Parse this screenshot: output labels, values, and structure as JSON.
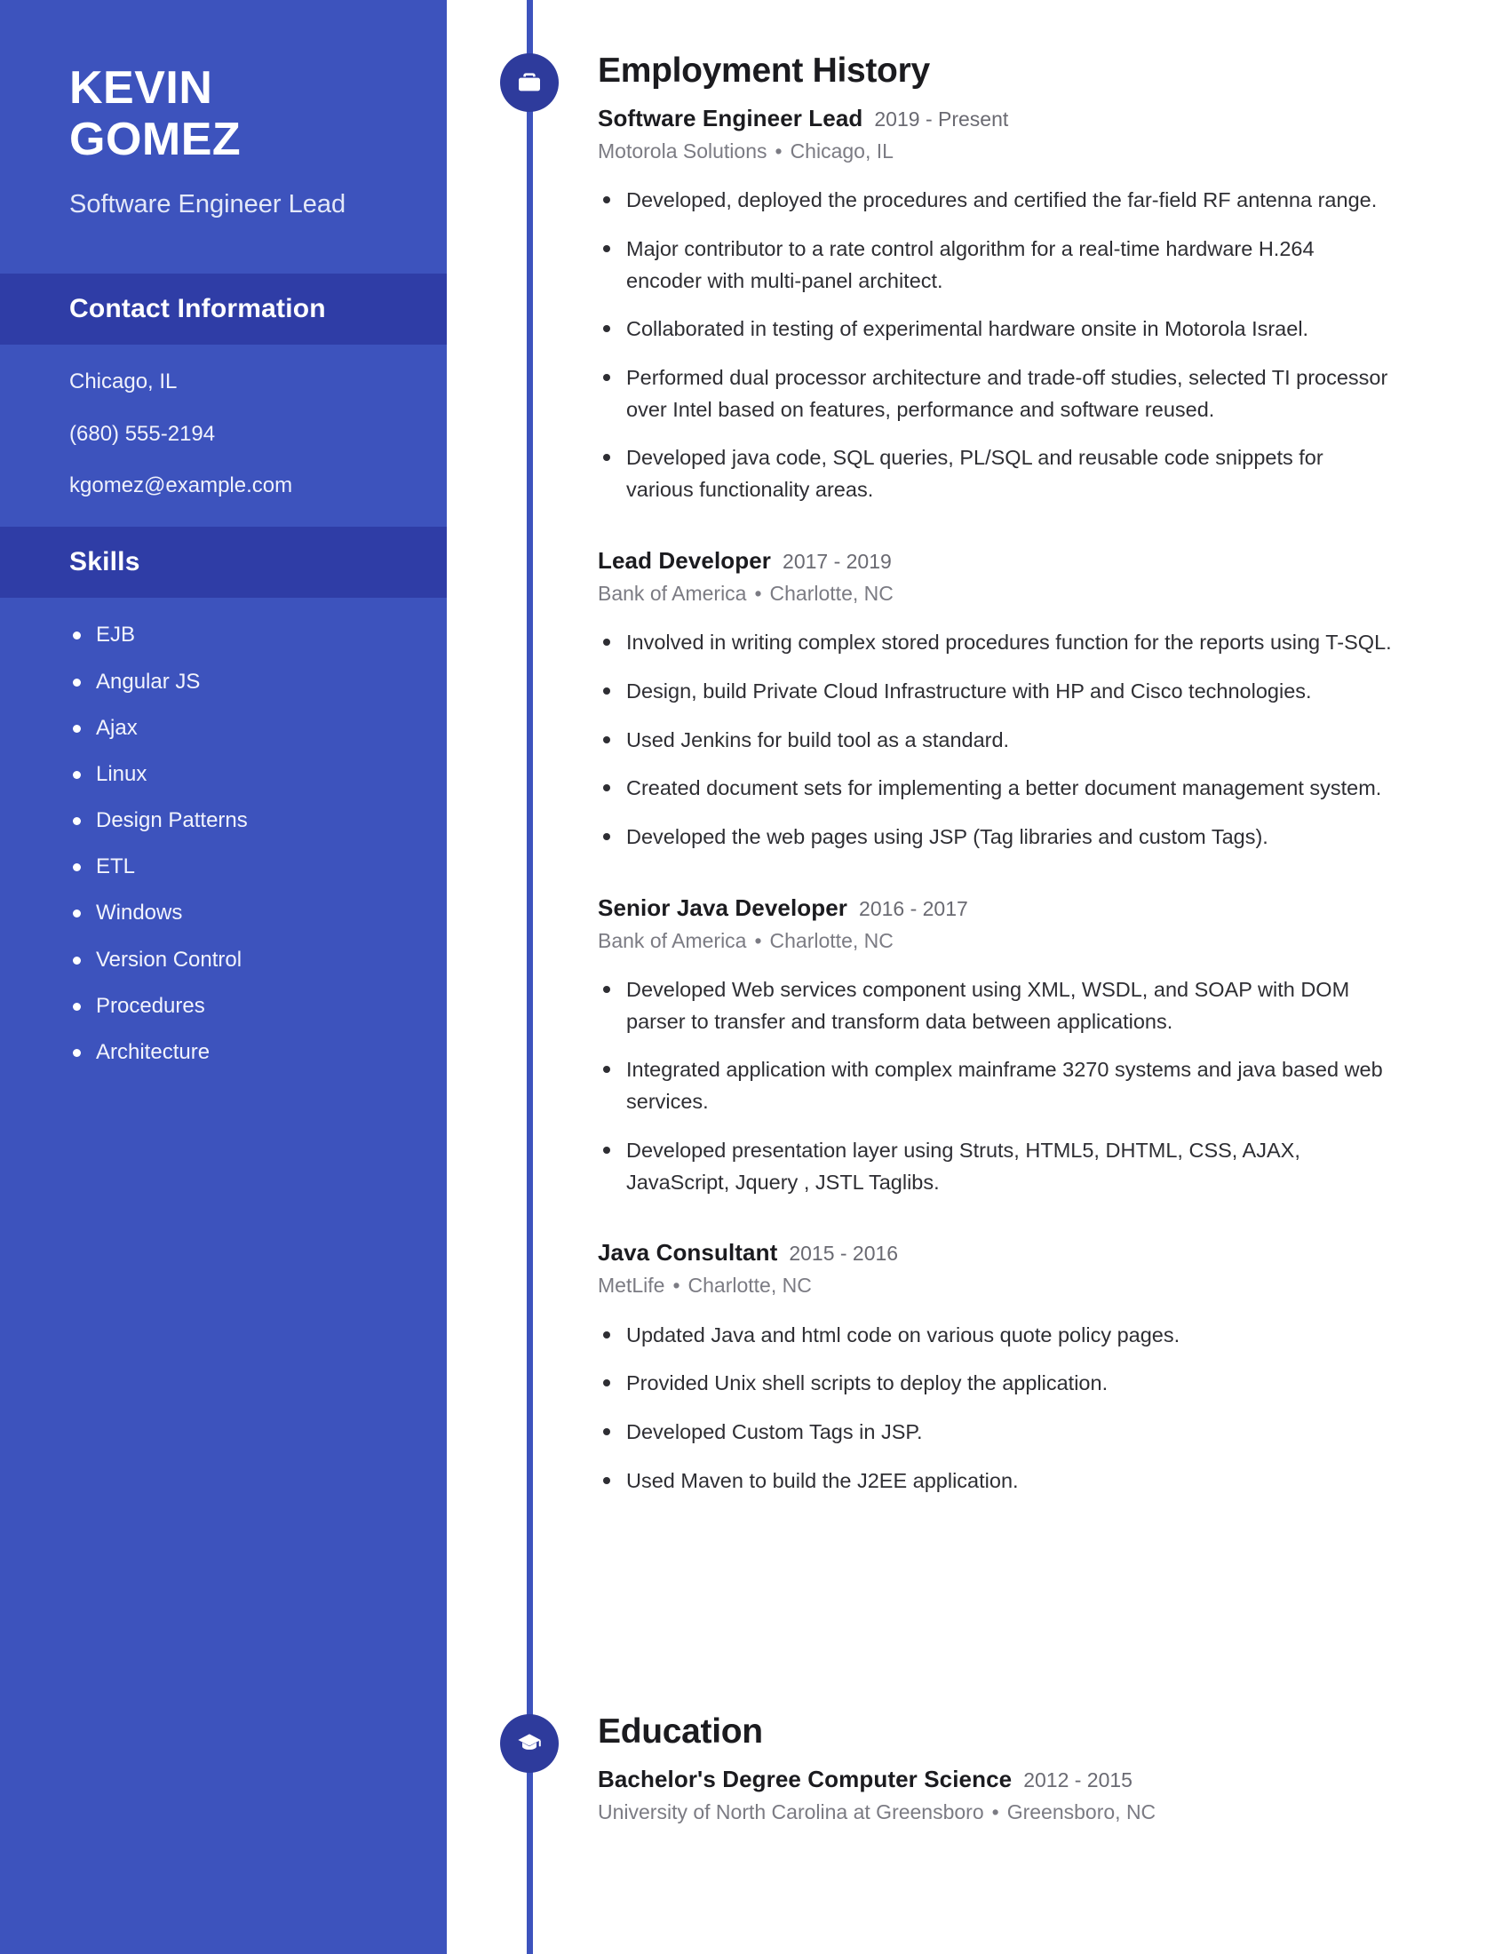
{
  "sidebar": {
    "name": "KEVIN GOMEZ",
    "job_title": "Software Engineer Lead",
    "contact": {
      "heading": "Contact Information",
      "location": "Chicago, IL",
      "phone": "(680) 555-2194",
      "email": "kgomez@example.com"
    },
    "skills": {
      "heading": "Skills",
      "items": [
        "EJB",
        "Angular JS",
        "Ajax",
        "Linux",
        "Design Patterns",
        "ETL",
        "Windows",
        "Version Control",
        "Procedures",
        "Architecture"
      ]
    },
    "colors": {
      "background": "#3d53bd",
      "section_header": "#2f3da6",
      "text": "#ffffff"
    }
  },
  "main": {
    "employment": {
      "icon": "briefcase-icon",
      "heading": "Employment History",
      "jobs": [
        {
          "title": "Software Engineer Lead",
          "dates": "2019 - Present",
          "company": "Motorola Solutions",
          "location": "Chicago, IL",
          "bullets": [
            "Developed, deployed the procedures and certified the far-field RF antenna range.",
            "Major contributor to a rate control algorithm for a real-time hardware H.264 encoder with multi-panel architect.",
            "Collaborated in testing of experimental hardware onsite in Motorola Israel.",
            "Performed dual processor architecture and trade-off studies, selected TI processor over Intel based on features, performance and software reused.",
            "Developed java code, SQL queries, PL/SQL and reusable code snippets for various functionality areas."
          ]
        },
        {
          "title": "Lead Developer",
          "dates": "2017 - 2019",
          "company": "Bank of America",
          "location": "Charlotte, NC",
          "bullets": [
            "Involved in writing complex stored procedures function for the reports using T-SQL.",
            "Design, build Private Cloud Infrastructure with HP and Cisco technologies.",
            "Used Jenkins for build tool as a standard.",
            "Created document sets for implementing a better document management system.",
            "Developed the web pages using JSP (Tag libraries and custom Tags)."
          ]
        },
        {
          "title": "Senior Java Developer",
          "dates": "2016 - 2017",
          "company": "Bank of America",
          "location": "Charlotte, NC",
          "bullets": [
            "Developed Web services component using XML, WSDL, and SOAP with DOM parser to transfer and transform data between applications.",
            "Integrated application with complex mainframe 3270 systems and java based web services.",
            "Developed presentation layer using Struts, HTML5, DHTML, CSS, AJAX, JavaScript, Jquery , JSTL Taglibs."
          ]
        },
        {
          "title": "Java Consultant",
          "dates": "2015 - 2016",
          "company": "MetLife",
          "location": "Charlotte, NC",
          "bullets": [
            "Updated Java and html code on various quote policy pages.",
            "Provided Unix shell scripts to deploy the application.",
            "Developed Custom Tags in JSP.",
            "Used Maven to build the J2EE application."
          ]
        }
      ]
    },
    "education": {
      "icon": "graduation-cap-icon",
      "heading": "Education",
      "entries": [
        {
          "title": "Bachelor's Degree Computer Science",
          "dates": "2012 - 2015",
          "school": "University of North Carolina at Greensboro",
          "location": "Greensboro, NC"
        }
      ]
    },
    "separator": "•",
    "colors": {
      "timeline": "#3d53bd",
      "marker": "#2e3b9c",
      "heading_text": "#1b1b1f",
      "body_text": "#2e2e33",
      "muted_text": "#7b7b83"
    }
  }
}
